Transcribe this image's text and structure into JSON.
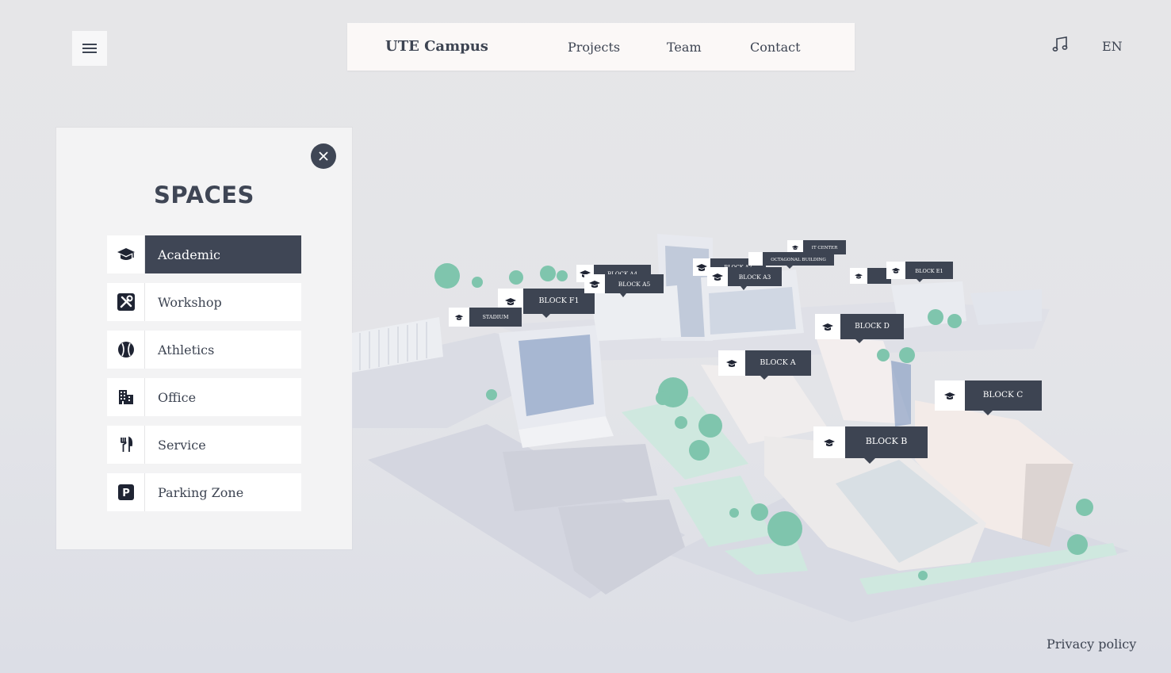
{
  "header": {
    "brand": "UTE Campus",
    "nav": [
      "Projects",
      "Team",
      "Contact"
    ],
    "language": "EN"
  },
  "icons": {
    "menu": "hamburger-icon",
    "music": "music-note-icon",
    "close": "close-icon"
  },
  "panel": {
    "title": "SPACES",
    "items": [
      {
        "label": "Academic",
        "icon": "graduation-cap-icon",
        "active": true
      },
      {
        "label": "Workshop",
        "icon": "tools-icon",
        "active": false
      },
      {
        "label": "Athletics",
        "icon": "baseball-icon",
        "active": false
      },
      {
        "label": "Office",
        "icon": "building-icon",
        "active": false
      },
      {
        "label": "Service",
        "icon": "utensils-icon",
        "active": false
      },
      {
        "label": "Parking Zone",
        "icon": "parking-icon",
        "active": false
      }
    ]
  },
  "map": {
    "labels": [
      "BLOCK F1",
      "STADIUM",
      "BLOCK A4",
      "BLOCK A5",
      "BLOCK A2",
      "BLOCK A3",
      "IT CENTER",
      "OCTAGONAL BUILDING",
      "BLOCK E1",
      "BLOCK D",
      "BLOCK A",
      "BLOCK C",
      "BLOCK B"
    ]
  },
  "footer": {
    "privacy": "Privacy policy"
  },
  "colors": {
    "accent": "#3f4655",
    "panel": "#f3f3f4",
    "nav_bg": "#fbf8f7",
    "tree": "#7fc5ad",
    "lawn": "#cfe8df"
  }
}
